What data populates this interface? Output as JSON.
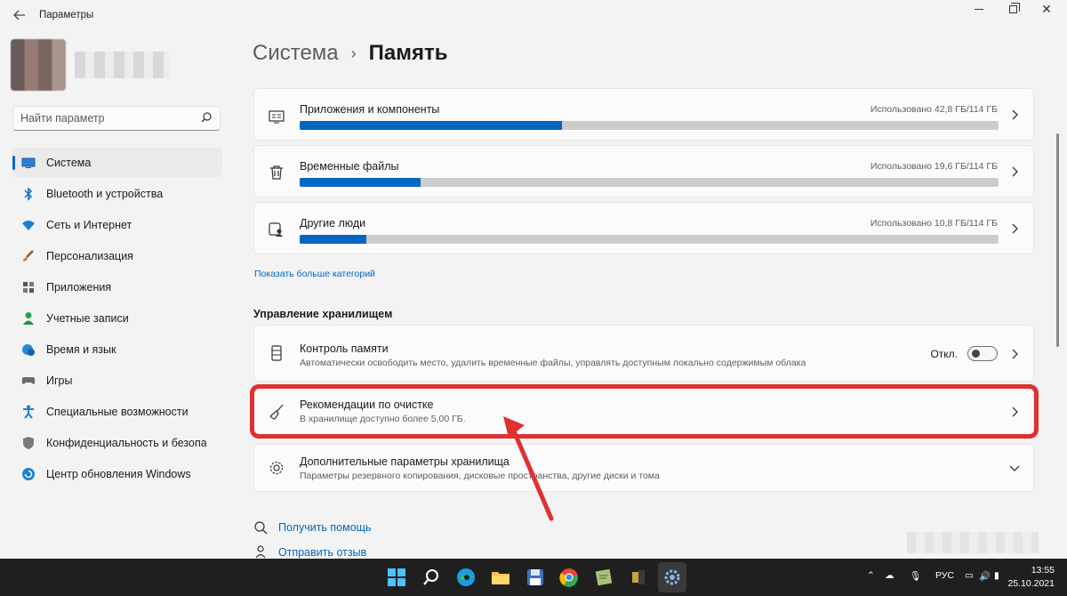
{
  "window": {
    "app_title": "Параметры",
    "back_icon": "arrow-left-icon"
  },
  "sidebar": {
    "search_placeholder": "Найти параметр",
    "items": [
      {
        "label": "Система",
        "icon": "monitor-icon",
        "active": true
      },
      {
        "label": "Bluetooth и устройства",
        "icon": "bluetooth-icon"
      },
      {
        "label": "Сеть и Интернет",
        "icon": "wifi-icon"
      },
      {
        "label": "Персонализация",
        "icon": "brush-icon"
      },
      {
        "label": "Приложения",
        "icon": "apps-icon"
      },
      {
        "label": "Учетные записи",
        "icon": "person-icon"
      },
      {
        "label": "Время и язык",
        "icon": "globe-clock-icon"
      },
      {
        "label": "Игры",
        "icon": "gamepad-icon"
      },
      {
        "label": "Специальные возможности",
        "icon": "accessibility-icon"
      },
      {
        "label": "Конфиденциальность и безопасность",
        "icon": "shield-icon"
      },
      {
        "label": "Центр обновления Windows",
        "icon": "update-icon"
      }
    ]
  },
  "breadcrumb": {
    "parent": "Система",
    "separator": "›",
    "current": "Память"
  },
  "storage_categories": [
    {
      "title": "Приложения и компоненты",
      "usage": "Использовано 42,8 ГБ/114 ГБ",
      "used_fraction": 0.375,
      "icon": "apps-list-icon"
    },
    {
      "title": "Временные файлы",
      "usage": "Использовано 19,6 ГБ/114 ГБ",
      "used_fraction": 0.173,
      "icon": "trash-icon"
    },
    {
      "title": "Другие люди",
      "usage": "Использовано 10,8 ГБ/114 ГБ",
      "used_fraction": 0.095,
      "icon": "people-icon"
    }
  ],
  "more_link": "Показать больше категорий",
  "management": {
    "section_title": "Управление хранилищем",
    "storage_sense": {
      "title": "Контроль памяти",
      "subtitle": "Автоматически освободить место, удалить временные файлы, управлять доступным локально содержимым облака",
      "toggle_label": "Откл."
    },
    "cleanup": {
      "title": "Рекомендации по очистке",
      "subtitle": "В хранилище доступно более 5,00 ГБ."
    },
    "advanced": {
      "title": "Дополнительные параметры хранилища",
      "subtitle": "Параметры резервного копирования, дисковые пространства, другие диски и тома"
    }
  },
  "help": {
    "get_help": "Получить помощь",
    "feedback": "Отправить отзыв"
  },
  "taskbar": {
    "language": "РУС",
    "time": "13:55",
    "date": "25.10.2021"
  },
  "colors": {
    "accent": "#0067c0",
    "highlight": "#e03030"
  }
}
